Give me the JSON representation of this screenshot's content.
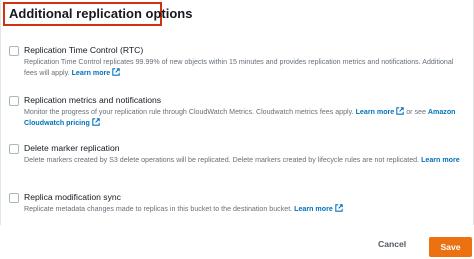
{
  "section": {
    "title": "Additional replication options"
  },
  "options": [
    {
      "title": "Replication Time Control (RTC)",
      "description": "Replication Time Control replicates 99.99% of new objects within 15 minutes and provides replication metrics and notifications. Additional fees will apply.",
      "link_text": "Learn more",
      "checked": false
    },
    {
      "title": "Replication metrics and notifications",
      "description": "Monitor the progress of your replication rule through CloudWatch Metrics. Cloudwatch metrics fees apply.",
      "link_text": "Learn more",
      "description_mid": "or see",
      "link2_text": "Amazon Cloudwatch pricing",
      "checked": false
    },
    {
      "title": "Delete marker replication",
      "description": "Delete markers created by S3 delete operations will be replicated. Delete markers created by lifecycle rules are not replicated.",
      "link_text": "Learn more",
      "checked": false
    },
    {
      "title": "Replica modification sync",
      "description": "Replicate metadata changes made to replicas in this bucket to the destination bucket.",
      "link_text": "Learn more",
      "checked": false
    }
  ],
  "footer": {
    "cancel_label": "Cancel",
    "save_label": "Save"
  },
  "colors": {
    "accent": "#ec7211",
    "link": "#0073bb",
    "highlight_border": "#d13212"
  },
  "icons": {
    "external_link": "external-link-icon"
  }
}
